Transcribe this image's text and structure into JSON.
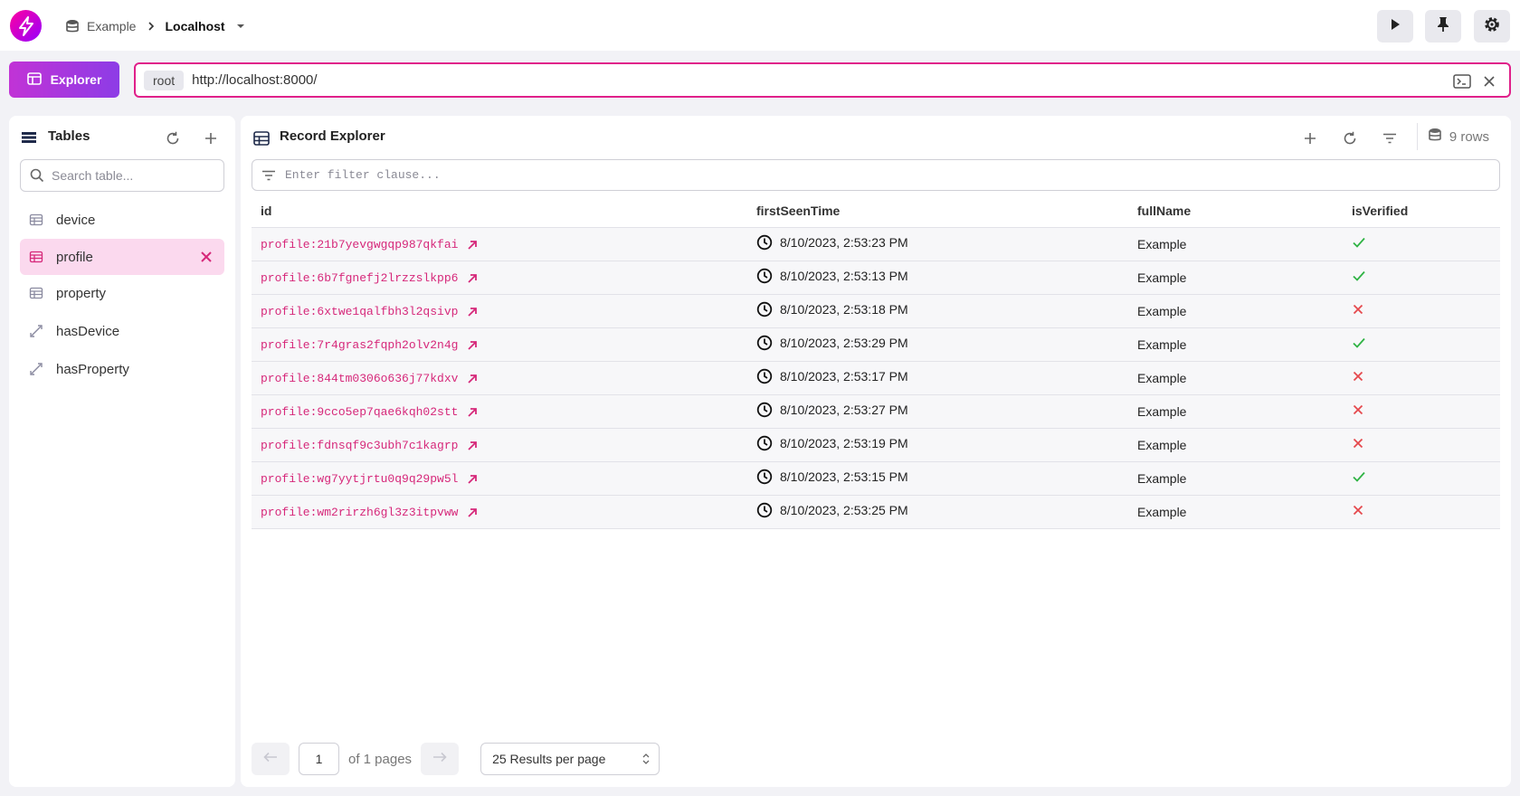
{
  "header": {
    "namespace": "Example",
    "database": "Localhost"
  },
  "toolbar": {
    "explorer_label": "Explorer"
  },
  "query_bar": {
    "user": "root",
    "endpoint": "http://localhost:8000/"
  },
  "tables_panel": {
    "title": "Tables",
    "search_placeholder": "Search table...",
    "items": [
      {
        "label": "device",
        "type": "table"
      },
      {
        "label": "profile",
        "type": "table",
        "active": true
      },
      {
        "label": "property",
        "type": "table"
      },
      {
        "label": "hasDevice",
        "type": "edge"
      },
      {
        "label": "hasProperty",
        "type": "edge"
      }
    ]
  },
  "record_explorer": {
    "title": "Record Explorer",
    "rows_count": "9 rows",
    "filter_placeholder": "Enter filter clause...",
    "columns": [
      "id",
      "firstSeenTime",
      "fullName",
      "isVerified"
    ],
    "rows": [
      {
        "id": "profile:21b7yevgwgqp987qkfai",
        "time": "8/10/2023, 2:53:23 PM",
        "name": "Example",
        "verified": true
      },
      {
        "id": "profile:6b7fgnefj2lrzzslkpp6",
        "time": "8/10/2023, 2:53:13 PM",
        "name": "Example",
        "verified": true
      },
      {
        "id": "profile:6xtwe1qalfbh3l2qsivp",
        "time": "8/10/2023, 2:53:18 PM",
        "name": "Example",
        "verified": false
      },
      {
        "id": "profile:7r4gras2fqph2olv2n4g",
        "time": "8/10/2023, 2:53:29 PM",
        "name": "Example",
        "verified": true
      },
      {
        "id": "profile:844tm0306o636j77kdxv",
        "time": "8/10/2023, 2:53:17 PM",
        "name": "Example",
        "verified": false
      },
      {
        "id": "profile:9cco5ep7qae6kqh02stt",
        "time": "8/10/2023, 2:53:27 PM",
        "name": "Example",
        "verified": false
      },
      {
        "id": "profile:fdnsqf9c3ubh7c1kagrp",
        "time": "8/10/2023, 2:53:19 PM",
        "name": "Example",
        "verified": false
      },
      {
        "id": "profile:wg7yytjrtu0q9q29pw5l",
        "time": "8/10/2023, 2:53:15 PM",
        "name": "Example",
        "verified": true
      },
      {
        "id": "profile:wm2rirzh6gl3z3itpvww",
        "time": "8/10/2023, 2:53:25 PM",
        "name": "Example",
        "verified": false
      }
    ]
  },
  "pagination": {
    "page": "1",
    "of_pages": "of 1 pages",
    "per_page": "25 Results per page"
  },
  "colors": {
    "accent": "#d6287a",
    "brand_gradient_start": "#ff00a0",
    "brand_gradient_end": "#9600ff",
    "check": "#2fb344",
    "cross": "#e5484d"
  }
}
